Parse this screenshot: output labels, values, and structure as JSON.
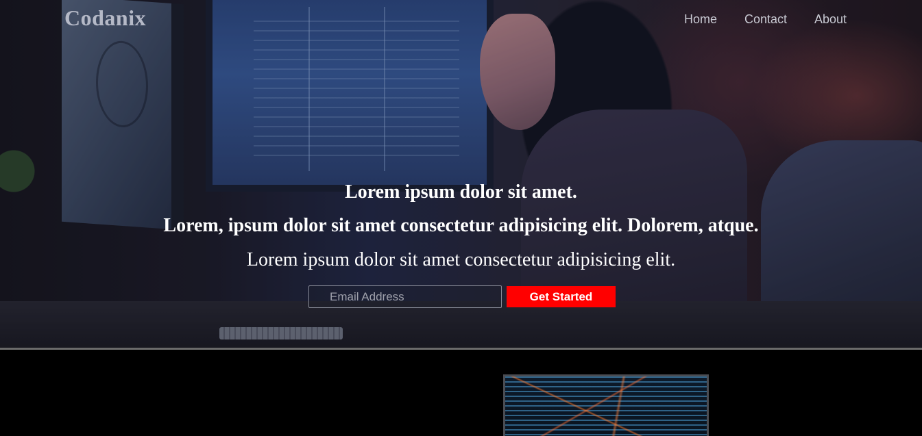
{
  "brand": "Codanix",
  "nav": [
    {
      "label": "Home"
    },
    {
      "label": "Contact"
    },
    {
      "label": "About"
    }
  ],
  "hero": {
    "heading": "Lorem ipsum dolor sit amet.",
    "subheading": "Lorem, ipsum dolor sit amet consectetur adipisicing elit. Dolorem, atque.",
    "text": "Lorem ipsum dolor sit amet consectetur adipisicing elit.",
    "email_placeholder": "Email Address",
    "cta_label": "Get Started"
  },
  "colors": {
    "cta": "#ff0000",
    "page_background": "#000000",
    "divider": "#6b6b6b"
  }
}
